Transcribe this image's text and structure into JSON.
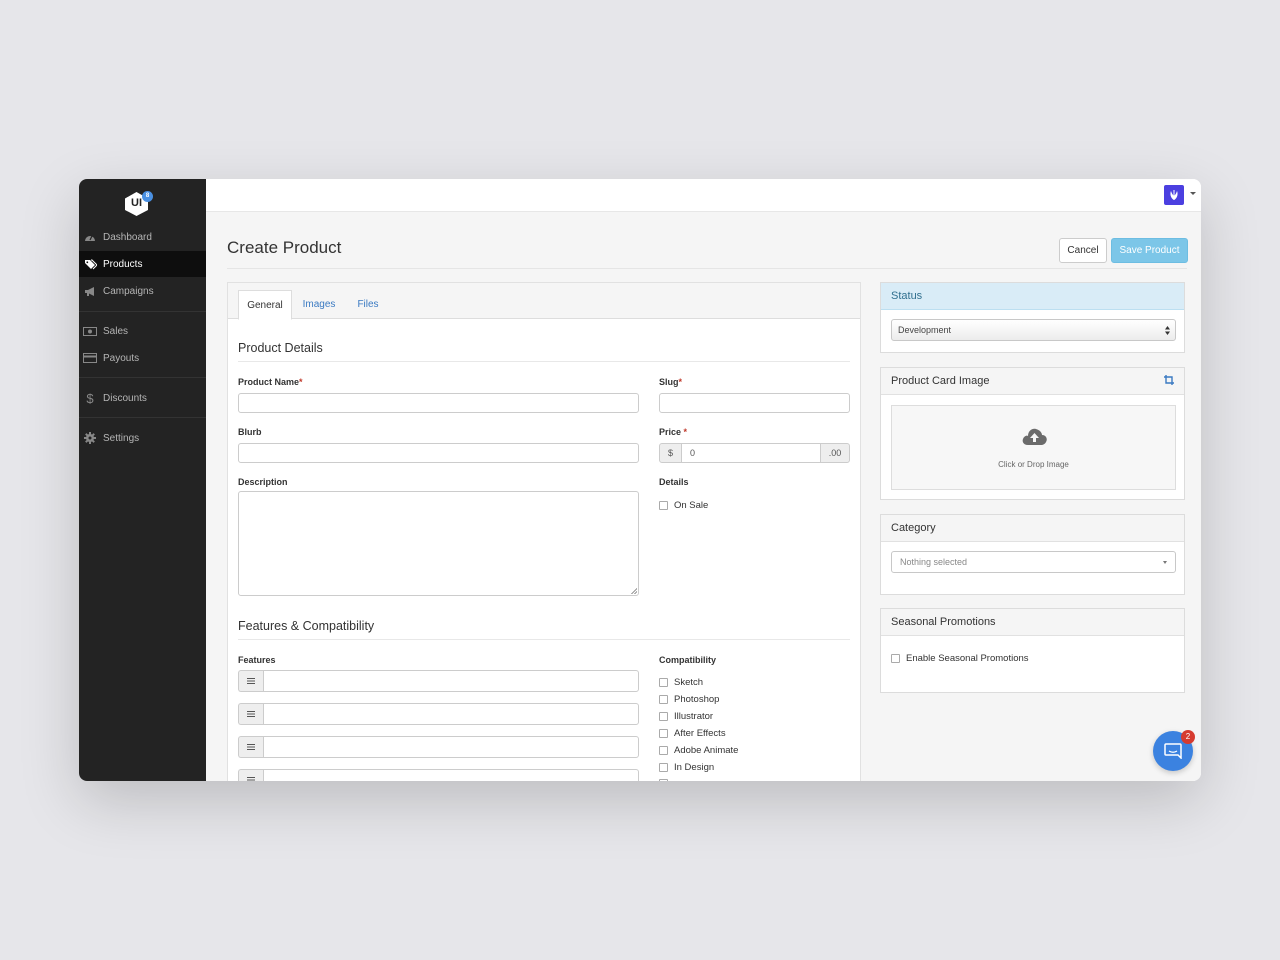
{
  "sidebar": {
    "logo_text": "UI",
    "logo_badge": "8",
    "items": [
      {
        "label": "Dashboard",
        "icon": "dashboard-icon"
      },
      {
        "label": "Products",
        "icon": "tags-icon",
        "active": true
      },
      {
        "label": "Campaigns",
        "icon": "bullhorn-icon"
      },
      {
        "label": "Sales",
        "icon": "money-icon"
      },
      {
        "label": "Payouts",
        "icon": "credit-card-icon"
      },
      {
        "label": "Discounts",
        "icon": "dollar-icon"
      },
      {
        "label": "Settings",
        "icon": "gear-icon"
      }
    ]
  },
  "header": {
    "title": "Create Product",
    "cancel_label": "Cancel",
    "save_label": "Save Product"
  },
  "tabs": [
    "General",
    "Images",
    "Files"
  ],
  "product_details": {
    "section_title": "Product Details",
    "product_name_label": "Product Name",
    "slug_label": "Slug",
    "blurb_label": "Blurb",
    "price_label": "Price",
    "price_prefix": "$",
    "price_value": "0",
    "price_suffix": ".00",
    "description_label": "Description",
    "details_label": "Details",
    "on_sale_label": "On Sale",
    "required_mark": "*"
  },
  "features": {
    "section_title": "Features & Compatibility",
    "features_label": "Features",
    "compat_label": "Compatibility",
    "compat_items": [
      "Sketch",
      "Photoshop",
      "Illustrator",
      "After Effects",
      "Adobe Animate",
      "In Design"
    ]
  },
  "status_card": {
    "title": "Status",
    "selected": "Development"
  },
  "image_card": {
    "title": "Product Card Image",
    "dropzone_text": "Click or Drop Image"
  },
  "category_card": {
    "title": "Category",
    "placeholder": "Nothing selected"
  },
  "seasonal_card": {
    "title": "Seasonal Promotions",
    "checkbox_label": "Enable Seasonal Promotions"
  },
  "chat": {
    "badge": "2"
  },
  "colors": {
    "accent": "#3a7ac2",
    "save_button": "#7cc6e8",
    "sidebar": "#232323",
    "avatar": "#4b3fe0",
    "chat": "#3b82e0",
    "badge": "#d63b30"
  }
}
